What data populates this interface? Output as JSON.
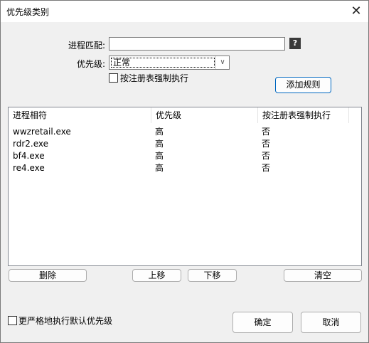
{
  "window": {
    "title": "优先级类别"
  },
  "form": {
    "process_match_label": "进程匹配:",
    "process_match_value": "",
    "help_icon_text": "?",
    "priority_label": "优先级:",
    "priority_value": "正常",
    "registry_checkbox_label": "按注册表强制执行",
    "registry_checkbox_checked": false,
    "add_rule_label": "添加规则"
  },
  "table": {
    "columns": [
      "进程相符",
      "优先级",
      "按注册表强制执行"
    ],
    "rows": [
      [
        "wwzretail.exe",
        "高",
        "否"
      ],
      [
        "rdr2.exe",
        "高",
        "否"
      ],
      [
        "bf4.exe",
        "高",
        "否"
      ],
      [
        "re4.exe",
        "高",
        "否"
      ]
    ]
  },
  "buttons": {
    "delete": "删除",
    "move_up": "上移",
    "move_down": "下移",
    "clear": "清空",
    "ok": "确定",
    "cancel": "取消"
  },
  "footer": {
    "strict_checkbox_label": "更严格地执行默认优先级",
    "strict_checkbox_checked": false
  }
}
